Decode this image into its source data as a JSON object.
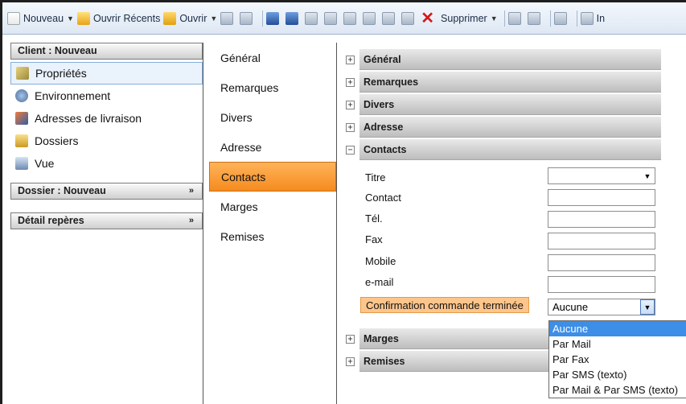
{
  "toolbar": {
    "items": [
      {
        "icon": "new-document-icon",
        "label": "Nouveau",
        "dropdown": true
      },
      {
        "icon": "recent-folder-icon",
        "label": "Ouvrir Récents",
        "dropdown": false
      },
      {
        "icon": "open-folder-icon",
        "label": "Ouvrir",
        "dropdown": true
      }
    ],
    "delete_label": "Supprimer",
    "overflow_label": "In"
  },
  "left_nav": {
    "client_header": "Client : Nouveau",
    "items": [
      {
        "label": "Propriétés",
        "icon": "properties-icon",
        "selected": true
      },
      {
        "label": "Environnement",
        "icon": "environment-icon",
        "selected": false
      },
      {
        "label": "Adresses de livraison",
        "icon": "delivery-address-icon",
        "selected": false
      },
      {
        "label": "Dossiers",
        "icon": "folders-icon",
        "selected": false
      },
      {
        "label": "Vue",
        "icon": "view-icon",
        "selected": false
      }
    ],
    "dossier_header": "Dossier : Nouveau",
    "detail_header": "Détail repères"
  },
  "categories": [
    "Général",
    "Remarques",
    "Divers",
    "Adresse",
    "Contacts",
    "Marges",
    "Remises"
  ],
  "active_category": "Contacts",
  "sections": {
    "general": "Général",
    "remarques": "Remarques",
    "divers": "Divers",
    "adresse": "Adresse",
    "contacts": "Contacts",
    "marges": "Marges",
    "remises": "Remises"
  },
  "contacts": {
    "fields": {
      "titre": {
        "label": "Titre",
        "value": ""
      },
      "contact": {
        "label": "Contact",
        "value": ""
      },
      "tel": {
        "label": "Tél.",
        "value": ""
      },
      "fax": {
        "label": "Fax",
        "value": ""
      },
      "mobile": {
        "label": "Mobile",
        "value": ""
      },
      "email": {
        "label": "e-mail",
        "value": ""
      }
    },
    "confirmation": {
      "label": "Confirmation commande terminée",
      "value": "Aucune",
      "options": [
        "Aucune",
        "Par Mail",
        "Par Fax",
        "Par SMS (texto)",
        "Par Mail & Par SMS (texto)"
      ],
      "highlighted_option": "Aucune"
    }
  },
  "colors": {
    "accent_orange": "#f58b1f",
    "selection_blue": "#3d8ee6",
    "nav_selected": "#eaf2fc"
  }
}
